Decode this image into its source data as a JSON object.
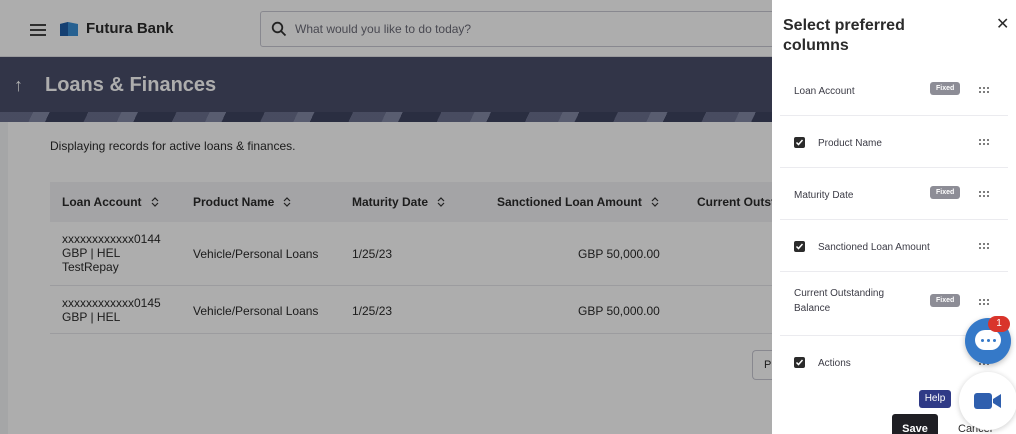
{
  "header": {
    "brand_name": "Futura Bank",
    "search_placeholder": "What would you like to do today?"
  },
  "banner": {
    "back_icon": "arrow-up-icon",
    "title": "Loans & Finances"
  },
  "content": {
    "info_text": "Displaying records for active loans & finances.",
    "columns": [
      "Loan Account",
      "Product Name",
      "Maturity Date",
      "Sanctioned Loan Amount",
      "Current Outst"
    ],
    "rows": [
      {
        "account_line1": "xxxxxxxxxxxx0144",
        "account_line2": "GBP | HEL",
        "account_line3": "TestRepay",
        "product": "Vehicle/Personal Loans",
        "maturity": "1/25/23",
        "sanctioned": "GBP 50,000.00"
      },
      {
        "account_line1": "xxxxxxxxxxxx0145",
        "account_line2": "GBP | HEL",
        "product": "Vehicle/Personal Loans",
        "maturity": "1/25/23",
        "sanctioned": "GBP 50,000.00"
      }
    ],
    "pager_label": "P"
  },
  "panel": {
    "title": "Select preferred columns",
    "close_icon": "close-icon",
    "fixed_label": "Fixed",
    "items": [
      {
        "label": "Loan Account",
        "fixed": true,
        "checked": false
      },
      {
        "label": "Product Name",
        "fixed": false,
        "checked": true
      },
      {
        "label": "Maturity Date",
        "fixed": true,
        "checked": false
      },
      {
        "label": "Sanctioned Loan Amount",
        "fixed": false,
        "checked": true
      },
      {
        "label": "Current Outstanding Balance",
        "fixed": true,
        "checked": false
      },
      {
        "label": "Actions",
        "fixed": false,
        "checked": true
      }
    ],
    "save_label": "Save",
    "cancel_label": "Cancel"
  },
  "floating": {
    "chat_badge": "1",
    "help_label": "Help"
  },
  "colors": {
    "banner": "#4a4f6a",
    "chat_fab": "#3579c8",
    "badge": "#d9342b",
    "help": "#2f3a86",
    "save": "#1f1f24"
  }
}
